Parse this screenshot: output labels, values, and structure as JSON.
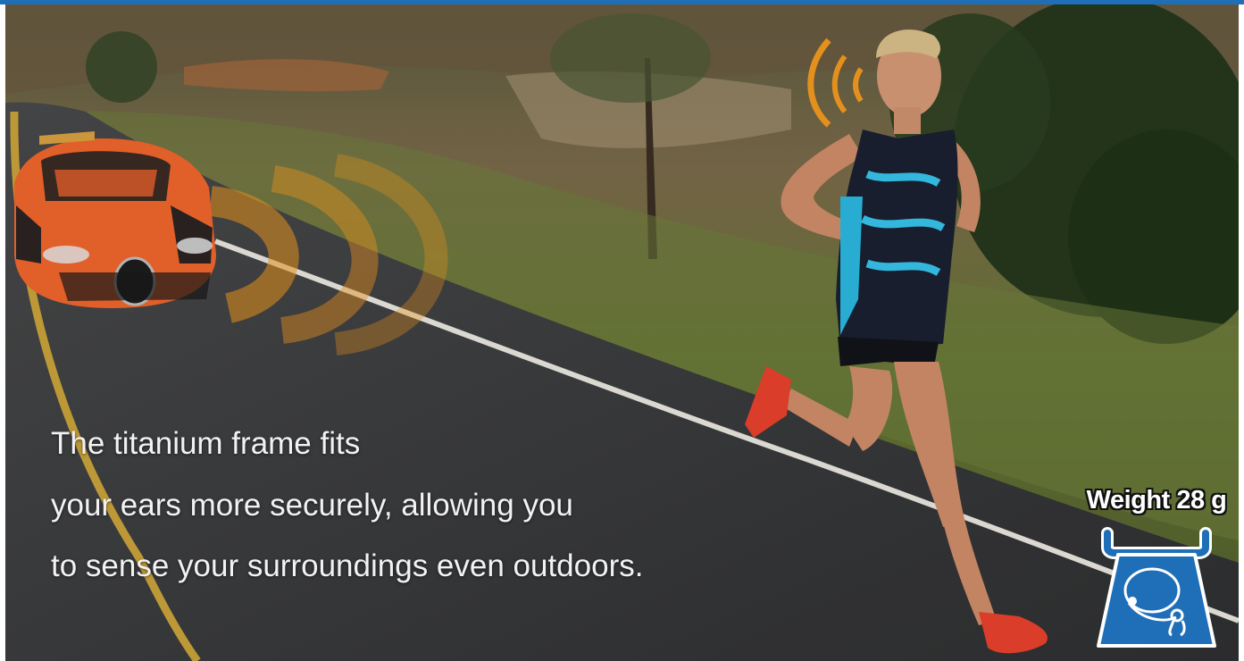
{
  "caption": {
    "line1": "The titanium frame fits",
    "line2": "your ears more securely, allowing you",
    "line3": "to sense your surroundings even outdoors."
  },
  "badge": {
    "weight_label": "Weight 28 g",
    "icon": "weighing-scale-headphone-icon"
  },
  "colors": {
    "accent_blue": "#1f6fb8",
    "sound_wave_orange": "#f39a1e",
    "car_orange": "#f0652b",
    "road": "#3b3c3e"
  }
}
